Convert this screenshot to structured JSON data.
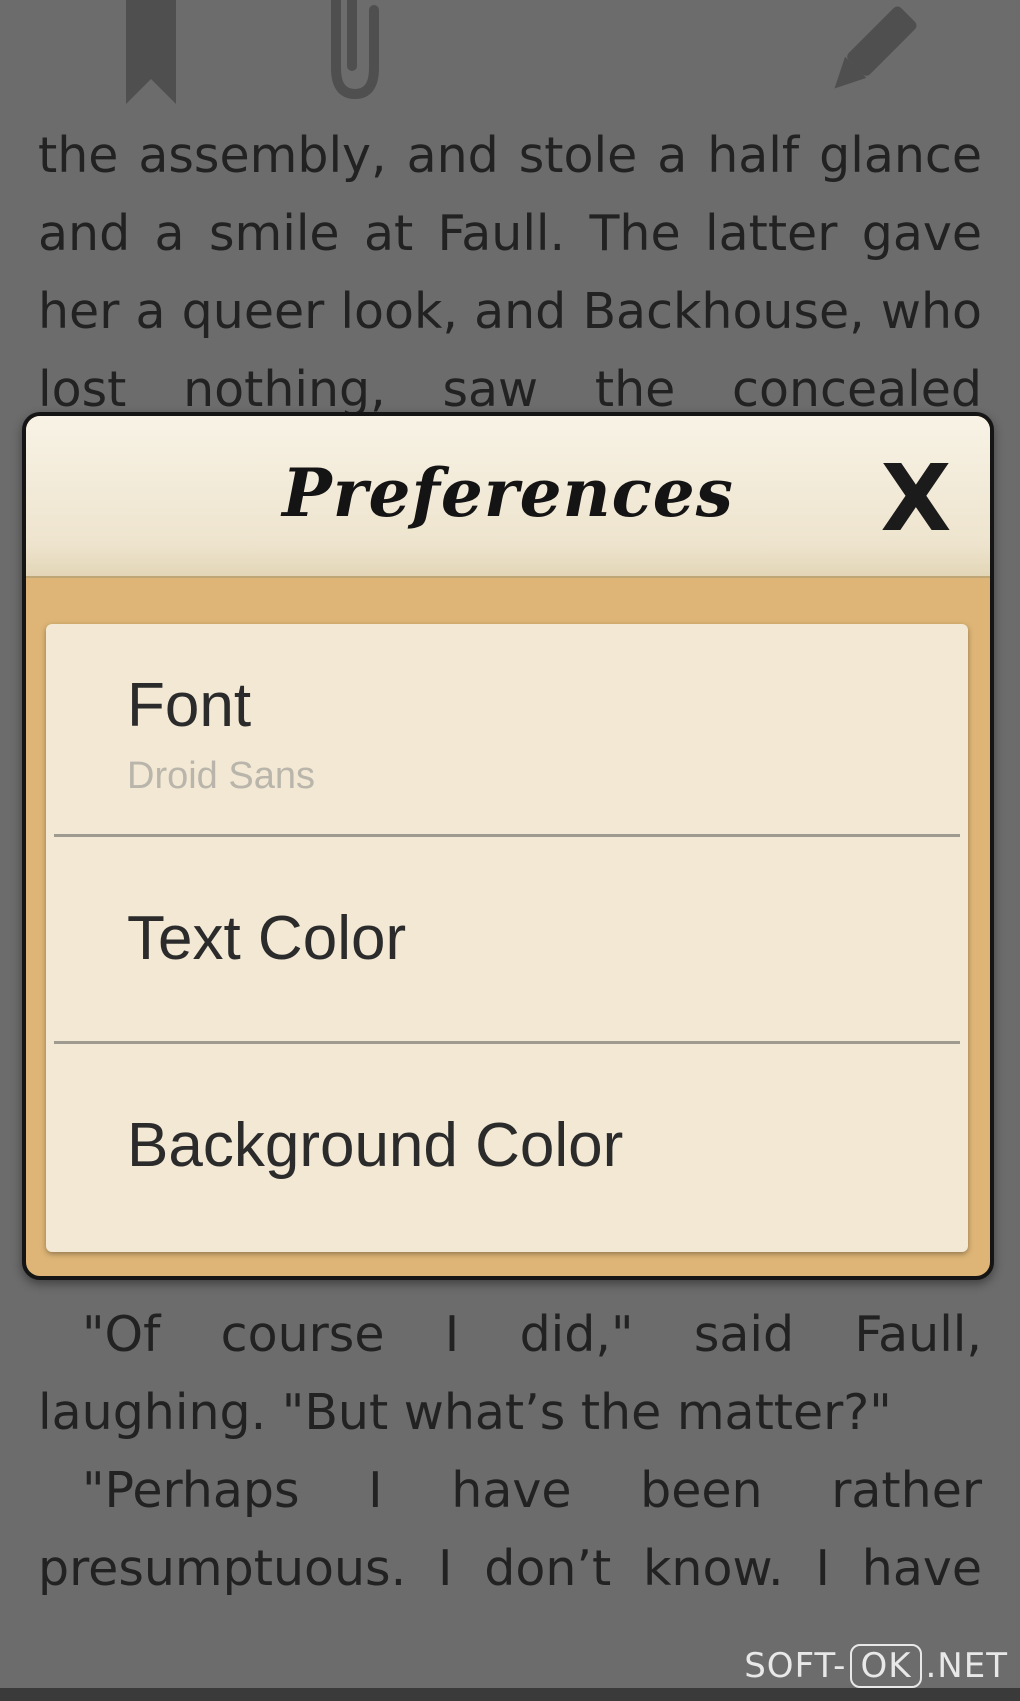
{
  "toolbar": {
    "icons": [
      "bookmark-icon",
      "paperclip-icon",
      "pencil-icon"
    ]
  },
  "reading_top": {
    "lines": [
      "the assembly, and stole a half glance",
      "and a smile at Faull. The latter gave",
      "her a queer look, and Backhouse, who",
      "lost nothing, saw the concealed"
    ]
  },
  "dialog": {
    "title": "Preferences",
    "close_label": "X",
    "items": [
      {
        "label": "Font",
        "value": "Droid Sans"
      },
      {
        "label": "Text Color"
      },
      {
        "label": "Background Color"
      }
    ]
  },
  "reading_bottom": {
    "lines": [
      "\"Of course I did,\" said Faull,",
      "laughing. \"But what’s the matter?\"",
      "\"Perhaps I have been rather",
      "presumptuous. I don’t know. I have"
    ]
  },
  "watermark": {
    "part1": "SOFT-",
    "part2": "OK",
    "part3": ".NET"
  },
  "colors": {
    "page_background": "#6c6c6c",
    "dialog_frame": "#deb576",
    "dialog_list": "#f2e8d4"
  }
}
